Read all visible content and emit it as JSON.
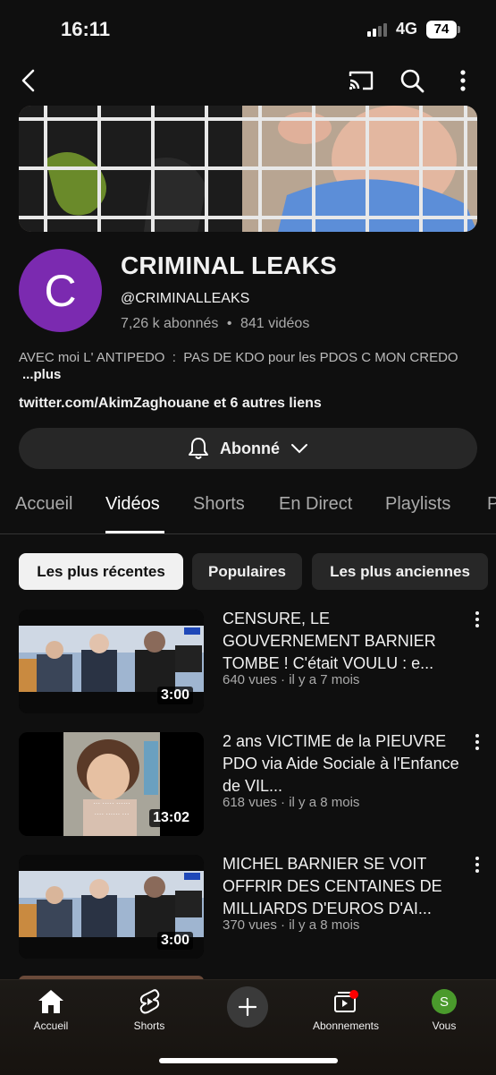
{
  "status": {
    "time": "16:11",
    "network": "4G",
    "battery": "74"
  },
  "topbar": {
    "back_icon": "back-arrow-icon",
    "cast_icon": "cast-icon",
    "search_icon": "search-icon",
    "more_icon": "more-vert-icon"
  },
  "channel": {
    "avatar_letter": "C",
    "name": "CRIMINAL LEAKS",
    "handle": "@CRIMINALLEAKS",
    "subscribers": "7,26 k abonnés",
    "separator": "•",
    "videos": "841 vidéos",
    "description": "AVEC moi L' ANTIPEDO  :  PAS DE KDO pour les PDOS C MON CREDO",
    "more": "...plus",
    "links_domain": "twitter.com/AkimZaghouane",
    "links_suffix": " et 6 autres liens",
    "subscribe_label": "Abonné"
  },
  "tabs": [
    "Accueil",
    "Vidéos",
    "Shorts",
    "En Direct",
    "Playlists",
    "P"
  ],
  "chips": [
    "Les plus récentes",
    "Populaires",
    "Les plus anciennes"
  ],
  "videos": [
    {
      "title": "CENSURE, LE GOUVERNEMENT BARNIER TOMBE ! C'était VOULU : e...",
      "meta": "640 vues · il y a 7 mois",
      "duration": "3:00"
    },
    {
      "title": "2 ans VICTIME de la PIEUVRE PDO via Aide Sociale à l'Enfance de VIL...",
      "meta": "618 vues · il y a 8 mois",
      "duration": "13:02"
    },
    {
      "title": "MICHEL BARNIER SE VOIT OFFRIR DES CENTAINES DE MILLIARDS D'EUROS D'AI...",
      "meta": "370 vues · il y a 8 mois",
      "duration": "3:00"
    }
  ],
  "nav": {
    "home": "Accueil",
    "shorts": "Shorts",
    "subs": "Abonnements",
    "you": "Vous",
    "you_letter": "S"
  },
  "colors": {
    "background": "#0f0f0f",
    "avatar": "#7b2ab0",
    "accent_red": "#ff0000"
  }
}
